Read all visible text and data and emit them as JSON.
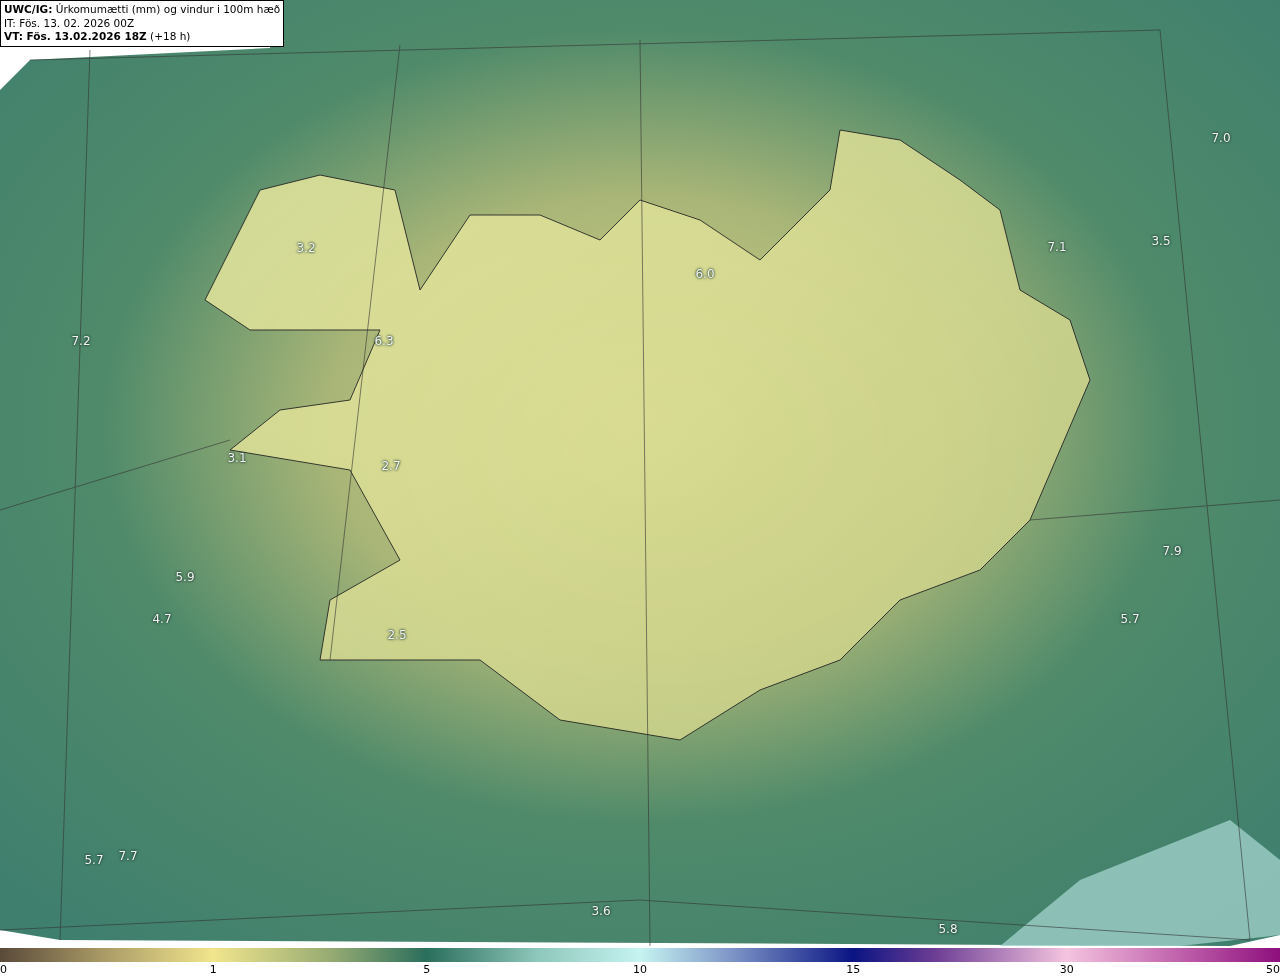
{
  "header": {
    "title": "UWC/IG:",
    "subtitle": "Úrkomumætti (mm) og vindur i 100m hæð",
    "init_time": "IT: Fös. 13. 02. 2026 00Z",
    "valid_time": "VT: Fös. 13.02.2026 18Z",
    "lead": "(+18 h)"
  },
  "map": {
    "labels": [
      "7.0",
      "3.2",
      "3.5",
      "7.1",
      "6.0",
      "7.2",
      "6.3",
      "3.1",
      "2.7",
      "7.9",
      "5.9",
      "4.7",
      "5.7",
      "2.5",
      "7.7",
      "5.7",
      "3.6",
      "5.8"
    ]
  },
  "colorbar": {
    "ticks": [
      "0",
      "1",
      "5",
      "10",
      "15",
      "30",
      "50"
    ]
  }
}
